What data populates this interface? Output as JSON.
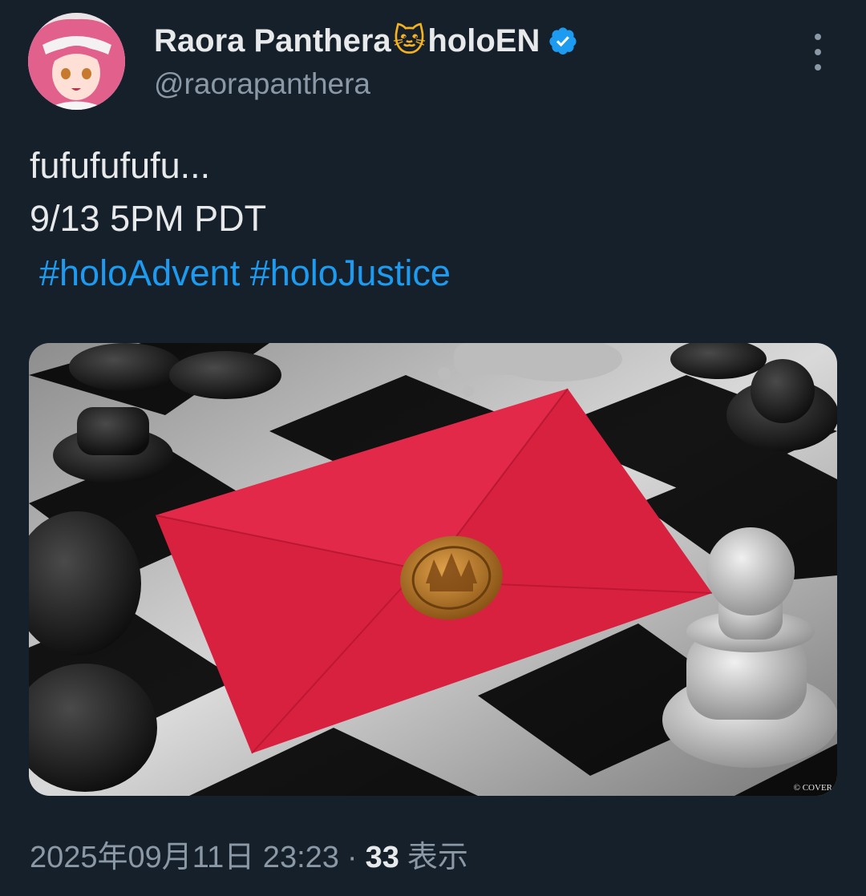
{
  "author": {
    "display_name": "Raora Panthera",
    "name_emoji": "🐱",
    "name_suffix": "holoEN",
    "handle": "@raorapanthera",
    "verified": true,
    "verified_color": "#1d9bf0"
  },
  "tweet": {
    "text_lines": [
      "fufufufufu...",
      "9/13 5PM PDT"
    ],
    "hashtags": [
      "#holoAdvent",
      "#holoJustice"
    ]
  },
  "media": {
    "watermark": "© COVER"
  },
  "meta": {
    "timestamp": "2025年09月11日 23:23",
    "separator": "·",
    "views_count": "33",
    "views_label": "表示"
  },
  "colors": {
    "background": "#15202b",
    "primary_text": "#e7e9ea",
    "secondary_text": "#8b98a5",
    "link": "#1d9bf0",
    "envelope": "#d8213f"
  },
  "icons": [
    "avatar",
    "verified-badge-icon",
    "more-options-icon"
  ]
}
